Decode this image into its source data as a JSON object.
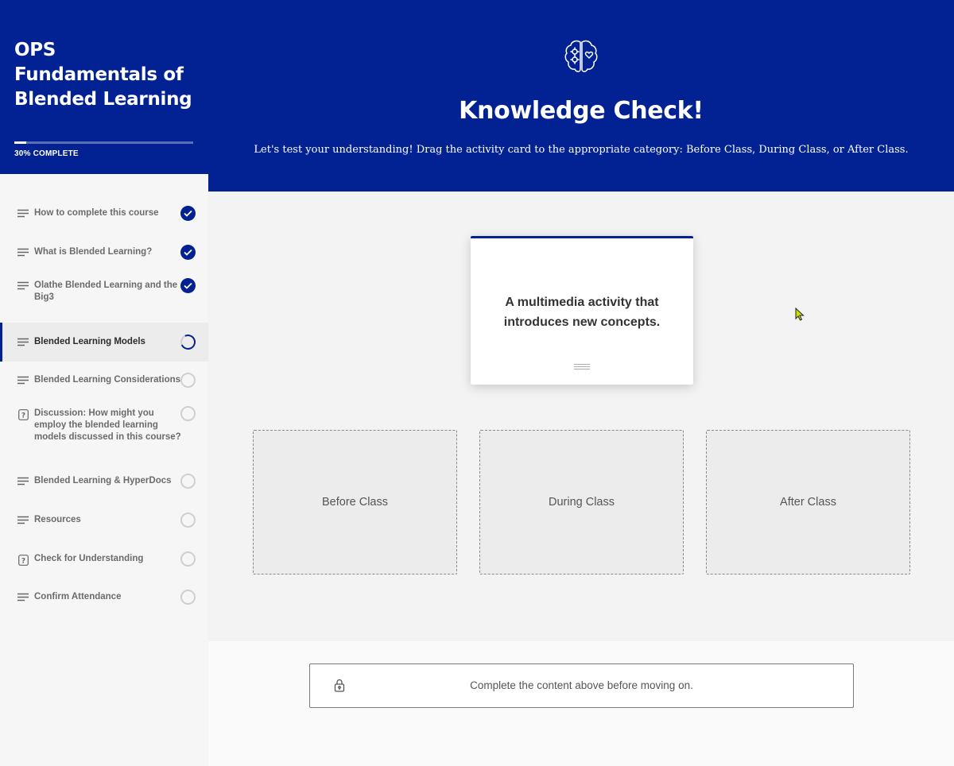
{
  "sidebar": {
    "course_title": "OPS Fundamentals of Blended Learning",
    "progress_text": "30% COMPLETE",
    "progress_fraction": 0.3,
    "items": [
      {
        "label": "How to complete this course",
        "icon": "lines-icon",
        "status": "complete"
      },
      {
        "label": "What is Blended Learning?",
        "icon": "lines-icon",
        "status": "complete"
      },
      {
        "label": "Olathe Blended Learning and the Big3",
        "icon": "lines-icon",
        "status": "complete"
      },
      {
        "label": "Blended Learning Models",
        "icon": "lines-icon",
        "status": "in-progress"
      },
      {
        "label": "Blended Learning Considerations",
        "icon": "lines-icon",
        "status": "not-started"
      },
      {
        "label": "Discussion: How might you employ the blended learning models discussed in this course?",
        "icon": "question-icon",
        "status": "not-started"
      },
      {
        "label": "Blended Learning & HyperDocs",
        "icon": "lines-icon",
        "status": "not-started"
      },
      {
        "label": "Resources",
        "icon": "lines-icon",
        "status": "not-started"
      },
      {
        "label": "Check for Understanding",
        "icon": "question-icon",
        "status": "not-started"
      },
      {
        "label": "Confirm Attendance",
        "icon": "lines-icon",
        "status": "not-started"
      }
    ]
  },
  "hero": {
    "icon": "brain-icon",
    "title": "Knowledge Check!",
    "subtitle": "Let's test your understanding!  Drag the activity card to the appropriate category:  Before Class, During Class, or After Class."
  },
  "activity": {
    "card_text": "A multimedia activity that introduces new concepts.",
    "drop_zones": [
      "Before Class",
      "During Class",
      "After Class"
    ]
  },
  "footer": {
    "lock_message": "Complete the content above before moving on."
  },
  "colors": {
    "brand": "#022193",
    "background": "#f3f3f3"
  }
}
